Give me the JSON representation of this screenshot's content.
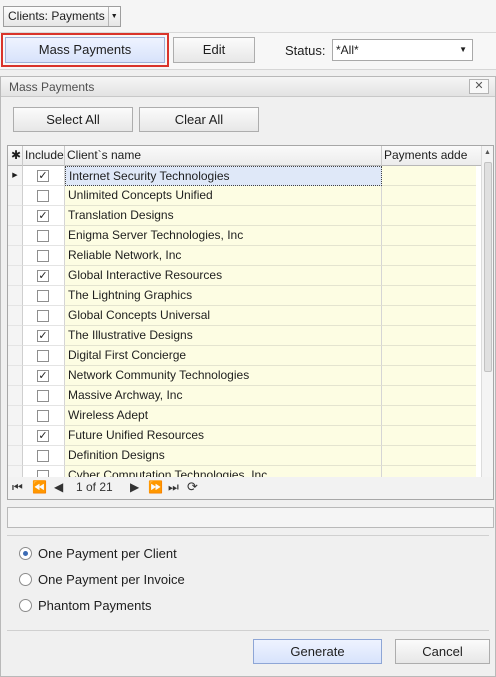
{
  "top": {
    "view_selector": "Clients: Payments",
    "mass_payments_label": "Mass Payments",
    "edit_label": "Edit",
    "status_label": "Status:",
    "status_value": "*All*"
  },
  "dialog": {
    "title": "Mass Payments",
    "close_glyph": "✕",
    "select_all_label": "Select All",
    "clear_all_label": "Clear All",
    "grid": {
      "headers": {
        "selector": "✱",
        "include": "Include",
        "client": "Client`s name",
        "payments": "Payments adde"
      },
      "rows": [
        {
          "name": "Internet Security Technologies",
          "include": true,
          "current": true
        },
        {
          "name": "Unlimited Concepts Unified",
          "include": false
        },
        {
          "name": "Translation Designs",
          "include": true
        },
        {
          "name": "Enigma Server Technologies, Inc",
          "include": false
        },
        {
          "name": "Reliable Network, Inc",
          "include": false
        },
        {
          "name": "Global Interactive Resources",
          "include": true
        },
        {
          "name": "The Lightning Graphics",
          "include": false
        },
        {
          "name": "Global Concepts Universal",
          "include": false
        },
        {
          "name": "The Illustrative Designs",
          "include": true
        },
        {
          "name": "Digital First Concierge",
          "include": false
        },
        {
          "name": "Network Community Technologies",
          "include": true
        },
        {
          "name": "Massive Archway, Inc",
          "include": false
        },
        {
          "name": "Wireless Adept",
          "include": false
        },
        {
          "name": "Future Unified Resources",
          "include": true
        },
        {
          "name": "Definition Designs",
          "include": false
        },
        {
          "name": "Cyber Computation Technologies, Inc",
          "include": false
        }
      ]
    },
    "navigator": {
      "page_text": "1 of 21"
    },
    "options": [
      {
        "label": "One Payment per Client",
        "selected": true
      },
      {
        "label": "One Payment per Invoice",
        "selected": false
      },
      {
        "label": "Phantom Payments",
        "selected": false
      }
    ],
    "generate_label": "Generate",
    "cancel_label": "Cancel"
  }
}
